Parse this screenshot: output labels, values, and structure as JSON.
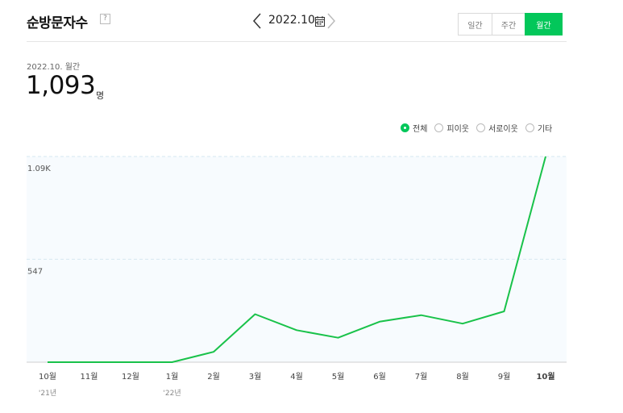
{
  "header": {
    "title": "순방문자수",
    "help_icon": "question-icon",
    "date_label": "2022.10.",
    "segments": [
      {
        "label": "일간",
        "active": false
      },
      {
        "label": "주간",
        "active": false
      },
      {
        "label": "월간",
        "active": true
      }
    ]
  },
  "summary": {
    "period": "2022.10. 월간",
    "total": "1,093",
    "unit": "명"
  },
  "legend": [
    {
      "label": "전체",
      "checked": true
    },
    {
      "label": "피이웃",
      "checked": false
    },
    {
      "label": "서로이웃",
      "checked": false
    },
    {
      "label": "기타",
      "checked": false
    }
  ],
  "colors": {
    "accent": "#03c75a",
    "line": "#19c24a",
    "plot_bg": "#f7fbfe",
    "grid": "#d6e7f0"
  },
  "chart_data": {
    "type": "line",
    "categories": [
      "10월",
      "11월",
      "12월",
      "1월",
      "2월",
      "3월",
      "4월",
      "5월",
      "6월",
      "7월",
      "8월",
      "9월",
      "10월"
    ],
    "category_sublabels": [
      "'21년",
      "",
      "",
      "'22년",
      "",
      "",
      "",
      "",
      "",
      "",
      "",
      "",
      ""
    ],
    "highlight_index": 12,
    "series": [
      {
        "values": [
          0,
          0,
          0,
          0,
          55,
          255,
          170,
          130,
          215,
          250,
          205,
          270,
          1093
        ]
      }
    ],
    "y_ticks": [
      {
        "value": 547,
        "label": "547"
      },
      {
        "value": 1093,
        "label": "1.09K"
      }
    ],
    "ylim": [
      0,
      1093
    ],
    "grid": true
  }
}
